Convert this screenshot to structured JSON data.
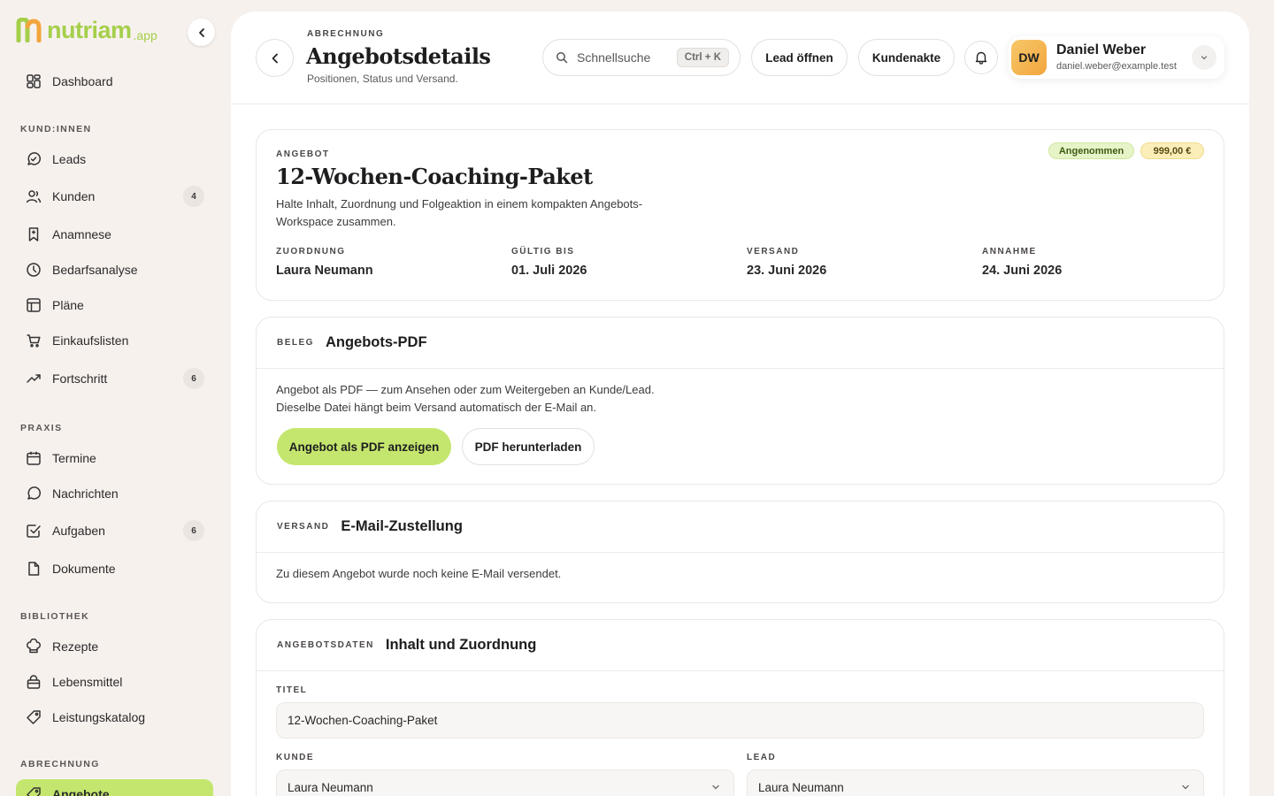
{
  "brand": {
    "name": "nutriam",
    "suffix": ".app",
    "accent": "#a5cf4a"
  },
  "sidebar": {
    "dashboard": "Dashboard",
    "sections": {
      "kundinnen": "KUND:INNEN",
      "praxis": "PRAXIS",
      "bibliothek": "BIBLIOTHEK",
      "abrechnung": "ABRECHNUNG"
    },
    "items": {
      "leads": "Leads",
      "kunden": "Kunden",
      "kunden_badge": "4",
      "anamnese": "Anamnese",
      "bedarfsanalyse": "Bedarfsanalyse",
      "plaene": "Pläne",
      "einkaufslisten": "Einkaufslisten",
      "fortschritt": "Fortschritt",
      "fortschritt_badge": "6",
      "termine": "Termine",
      "nachrichten": "Nachrichten",
      "aufgaben": "Aufgaben",
      "aufgaben_badge": "6",
      "dokumente": "Dokumente",
      "rezepte": "Rezepte",
      "lebensmittel": "Lebensmittel",
      "leistungskatalog": "Leistungskatalog",
      "angebote": "Angebote"
    }
  },
  "header": {
    "eyebrow": "ABRECHNUNG",
    "title": "Angebotsdetails",
    "subtitle": "Positionen, Status und Versand.",
    "search_placeholder": "Schnellsuche",
    "search_shortcut": "Ctrl + K",
    "lead_button": "Lead öffnen",
    "customer_button": "Kundenakte",
    "user": {
      "initials": "DW",
      "name": "Daniel Weber",
      "email": "daniel.weber@example.test"
    }
  },
  "offer": {
    "eyebrow": "ANGEBOT",
    "title": "12-Wochen-Coaching-Paket",
    "description": "Halte Inhalt, Zuordnung und Folgeaktion in einem kompakten Angebots-Workspace zusammen.",
    "status_badge": "Angenommen",
    "price_badge": "999,00 €",
    "meta": {
      "assignment_label": "ZUORDNUNG",
      "assignment_value": "Laura Neumann",
      "valid_label": "GÜLTIG BIS",
      "valid_value": "01. Juli 2026",
      "sent_label": "VERSAND",
      "sent_value": "23. Juni 2026",
      "accepted_label": "ANNAHME",
      "accepted_value": "24. Juni 2026"
    }
  },
  "pdf": {
    "eyebrow": "BELEG",
    "title": "Angebots-PDF",
    "line1": "Angebot als PDF — zum Ansehen oder zum Weitergeben an Kunde/Lead.",
    "line2": "Dieselbe Datei hängt beim Versand automatisch der E-Mail an.",
    "view_button": "Angebot als PDF anzeigen",
    "download_button": "PDF herunterladen"
  },
  "email": {
    "eyebrow": "VERSAND",
    "title": "E-Mail-Zustellung",
    "text": "Zu diesem Angebot wurde noch keine E-Mail versendet."
  },
  "form": {
    "eyebrow": "ANGEBOTSDATEN",
    "title": "Inhalt und Zuordnung",
    "title_label": "TITEL",
    "title_value": "12-Wochen-Coaching-Paket",
    "customer_label": "KUNDE",
    "customer_value": "Laura Neumann",
    "lead_label": "LEAD",
    "lead_value": "Laura Neumann"
  },
  "colors": {
    "accent_green": "#c4e66e",
    "status_badge_bg": "#e6f4c8",
    "price_badge_bg": "#fbeeb8",
    "sidebar_bg": "#f7f1ee"
  }
}
